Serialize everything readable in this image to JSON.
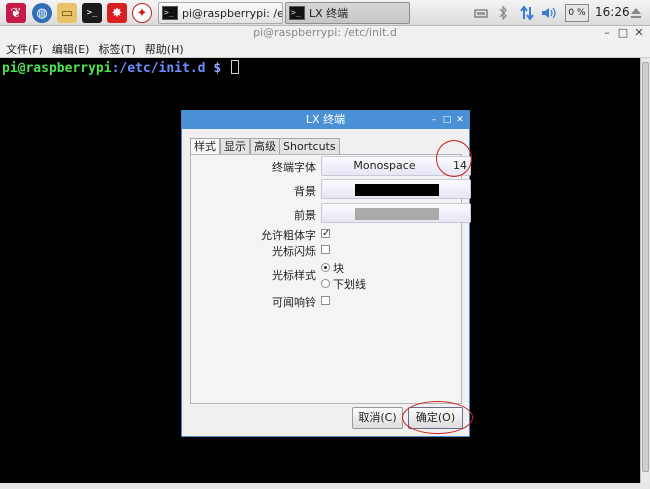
{
  "taskbar": {
    "launchers": [
      {
        "icon": "raspberry-menu-icon",
        "glyph": "❦"
      },
      {
        "icon": "web-browser-icon",
        "glyph": "◍"
      },
      {
        "icon": "file-manager-icon",
        "glyph": "▭"
      },
      {
        "icon": "terminal-launcher-icon",
        "glyph": ">_"
      },
      {
        "icon": "math-app-icon",
        "glyph": "✸"
      },
      {
        "icon": "wolfram-icon",
        "glyph": "✦"
      }
    ],
    "tasks": [
      {
        "label": "pi@raspberrypi: /etc/...",
        "active": false
      },
      {
        "label": "LX 终端",
        "active": true
      }
    ],
    "tray": {
      "network_icon": "network-icon",
      "bluetooth_icon": "bluetooth-icon",
      "updown_icon": "transfer-icon",
      "volume_icon": "volume-icon",
      "cpu": "0 %",
      "time": "16:26",
      "eject_icon": "eject-icon"
    }
  },
  "terminal": {
    "title": "pi@raspberrypi: /etc/init.d",
    "menu": [
      "文件(F)",
      "编辑(E)",
      "标签(T)",
      "帮助(H)"
    ],
    "prompt_user": "pi@raspberrypi",
    "prompt_path": ":/etc/init.d",
    "prompt_symbol": " $ "
  },
  "dialog": {
    "title": "LX 终端",
    "tabs": [
      "样式",
      "显示",
      "高级",
      "Shortcuts"
    ],
    "active_tab": "样式",
    "font_label": "终端字体",
    "font_name": "Monospace",
    "font_size": "14",
    "background_label": "背景",
    "background_color": "#000000",
    "foreground_label": "前景",
    "foreground_color": "#aaaaaa",
    "bold_label": "允许粗体字",
    "bold_checked": true,
    "blink_label": "光标闪烁",
    "blink_checked": false,
    "cursor_style_label": "光标样式",
    "cursor_options": [
      "块",
      "下划线"
    ],
    "cursor_selected": "块",
    "bell_label": "可闻响铃",
    "bell_checked": false,
    "cancel_label": "取消(C)",
    "ok_label": "确定(O)"
  },
  "colors": {
    "annotation": "#cc1f1f",
    "title_bar": "#4a90d6",
    "prompt_user": "#4fe34f",
    "prompt_path": "#6f8fff"
  }
}
